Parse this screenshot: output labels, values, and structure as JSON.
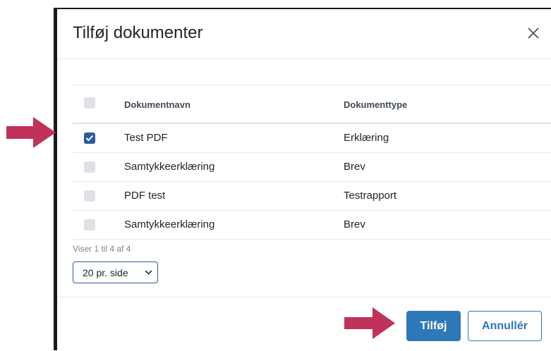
{
  "modal": {
    "title": "Tilføj dokumenter",
    "close_icon": "close-icon"
  },
  "table": {
    "columns": [
      "Dokumentnavn",
      "Dokumenttype"
    ],
    "header_checked": false,
    "rows": [
      {
        "name": "Test PDF",
        "type": "Erklæring",
        "checked": true
      },
      {
        "name": "Samtykkeerklæring",
        "type": "Brev",
        "checked": false
      },
      {
        "name": "PDF test",
        "type": "Testrapport",
        "checked": false
      },
      {
        "name": "Samtykkeerklæring",
        "type": "Brev",
        "checked": false
      }
    ]
  },
  "pagination": {
    "info": "Viser 1 til 4 af 4",
    "page_size": "20 pr. side"
  },
  "footer": {
    "add_label": "Tilføj",
    "cancel_label": "Annullér"
  },
  "annotations": {
    "arrow_icon": "right-arrow-icon",
    "arrow_color": "#c0325a"
  },
  "colors": {
    "primary": "#2e78b7",
    "checkbox_checked": "#2c5aa0",
    "checkbox_unchecked": "#dee2e6"
  }
}
